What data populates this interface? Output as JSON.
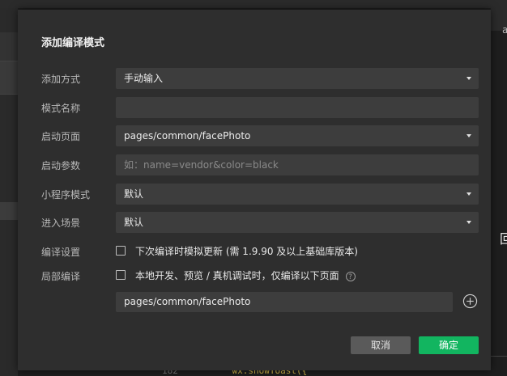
{
  "dialog": {
    "title": "添加编译模式",
    "rows": {
      "add_method": {
        "label": "添加方式",
        "value": "手动输入"
      },
      "mode_name": {
        "label": "模式名称",
        "value": ""
      },
      "start_page": {
        "label": "启动页面",
        "value": "pages/common/facePhoto"
      },
      "start_params": {
        "label": "启动参数",
        "placeholder": "如：name=vendor&color=black"
      },
      "mini_mode": {
        "label": "小程序模式",
        "value": "默认"
      },
      "scene": {
        "label": "进入场景",
        "value": "默认"
      },
      "compile_settings": {
        "label": "编译设置",
        "checkbox_text": "下次编译时模拟更新 (需 1.9.90 及以上基础库版本)",
        "checked": false
      },
      "partial_compile": {
        "label": "局部编译",
        "checkbox_text": "本地开发、预览 / 真机调试时，仅编译以下页面",
        "checked": false,
        "help_glyph": "?"
      }
    },
    "partial_page": "pages/common/facePhoto",
    "buttons": {
      "cancel": "取消",
      "ok": "确定"
    }
  },
  "background": {
    "right_letter": "a",
    "green_mark": "回",
    "code_line_number": "182",
    "code_snippet": "wx.showToast({"
  },
  "colors": {
    "primary": "#12b560",
    "dialog_bg": "#2e2e2e",
    "field_bg": "#3d3d3d"
  }
}
